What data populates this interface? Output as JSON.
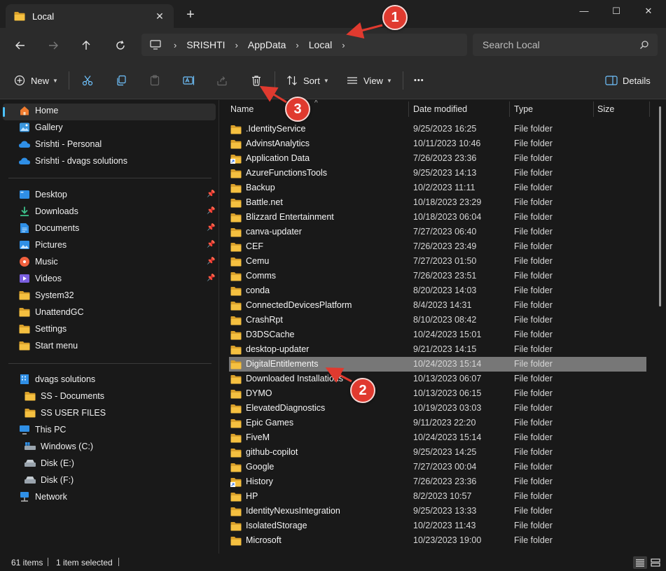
{
  "window": {
    "tab_title": "Local",
    "new_tab": "+",
    "minimize": "—",
    "maximize": "☐",
    "close": "✕"
  },
  "address": {
    "crumbs": [
      "SRISHTI",
      "AppData",
      "Local"
    ],
    "search_placeholder": "Search Local"
  },
  "toolbar": {
    "new_label": "New",
    "sort_label": "Sort",
    "view_label": "View",
    "more_label": "•••",
    "details_label": "Details"
  },
  "nav": {
    "quick": [
      "Home",
      "Gallery",
      "Srishti - Personal",
      "Srishti - dvags solutions"
    ],
    "pinned": [
      "Desktop",
      "Downloads",
      "Documents",
      "Pictures",
      "Music",
      "Videos",
      "System32",
      "UnattendGC",
      "Settings",
      "Start menu"
    ],
    "tree": [
      "dvags solutions",
      "SS - Documents",
      "SS USER FILES",
      "This PC",
      "Windows (C:)",
      "Disk (E:)",
      "Disk (F:)",
      "Network"
    ]
  },
  "columns": {
    "name": "Name",
    "date": "Date modified",
    "type": "Type",
    "size": "Size"
  },
  "files": [
    {
      "name": ".IdentityService",
      "date": "9/25/2023 16:25",
      "type": "File folder"
    },
    {
      "name": "AdvinstAnalytics",
      "date": "10/11/2023 10:46",
      "type": "File folder"
    },
    {
      "name": "Application Data",
      "date": "7/26/2023 23:36",
      "type": "File folder",
      "shortcut": true
    },
    {
      "name": "AzureFunctionsTools",
      "date": "9/25/2023 14:13",
      "type": "File folder"
    },
    {
      "name": "Backup",
      "date": "10/2/2023 11:11",
      "type": "File folder"
    },
    {
      "name": "Battle.net",
      "date": "10/18/2023 23:29",
      "type": "File folder"
    },
    {
      "name": "Blizzard Entertainment",
      "date": "10/18/2023 06:04",
      "type": "File folder"
    },
    {
      "name": "canva-updater",
      "date": "7/27/2023 06:40",
      "type": "File folder"
    },
    {
      "name": "CEF",
      "date": "7/26/2023 23:49",
      "type": "File folder"
    },
    {
      "name": "Cemu",
      "date": "7/27/2023 01:50",
      "type": "File folder"
    },
    {
      "name": "Comms",
      "date": "7/26/2023 23:51",
      "type": "File folder"
    },
    {
      "name": "conda",
      "date": "8/20/2023 14:03",
      "type": "File folder"
    },
    {
      "name": "ConnectedDevicesPlatform",
      "date": "8/4/2023 14:31",
      "type": "File folder"
    },
    {
      "name": "CrashRpt",
      "date": "8/10/2023 08:42",
      "type": "File folder"
    },
    {
      "name": "D3DSCache",
      "date": "10/24/2023 15:01",
      "type": "File folder"
    },
    {
      "name": "desktop-updater",
      "date": "9/21/2023 14:15",
      "type": "File folder"
    },
    {
      "name": "DigitalEntitlements",
      "date": "10/24/2023 15:14",
      "type": "File folder",
      "selected": true
    },
    {
      "name": "Downloaded Installations",
      "date": "10/13/2023 06:07",
      "type": "File folder"
    },
    {
      "name": "DYMO",
      "date": "10/13/2023 06:15",
      "type": "File folder"
    },
    {
      "name": "ElevatedDiagnostics",
      "date": "10/19/2023 03:03",
      "type": "File folder"
    },
    {
      "name": "Epic Games",
      "date": "9/11/2023 22:20",
      "type": "File folder"
    },
    {
      "name": "FiveM",
      "date": "10/24/2023 15:14",
      "type": "File folder"
    },
    {
      "name": "github-copilot",
      "date": "9/25/2023 14:25",
      "type": "File folder"
    },
    {
      "name": "Google",
      "date": "7/27/2023 00:04",
      "type": "File folder"
    },
    {
      "name": "History",
      "date": "7/26/2023 23:36",
      "type": "File folder",
      "shortcut": true
    },
    {
      "name": "HP",
      "date": "8/2/2023 10:57",
      "type": "File folder"
    },
    {
      "name": "IdentityNexusIntegration",
      "date": "9/25/2023 13:33",
      "type": "File folder"
    },
    {
      "name": "IsolatedStorage",
      "date": "10/2/2023 11:43",
      "type": "File folder"
    },
    {
      "name": "Microsoft",
      "date": "10/23/2023 19:00",
      "type": "File folder"
    }
  ],
  "status": {
    "count": "61 items",
    "selection": "1 item selected"
  },
  "annotations": [
    "1",
    "2",
    "3"
  ],
  "colors": {
    "folder": "#f5c040",
    "accent": "#4cc2ff",
    "badge": "#e03a2f",
    "selected_row": "#777777"
  }
}
